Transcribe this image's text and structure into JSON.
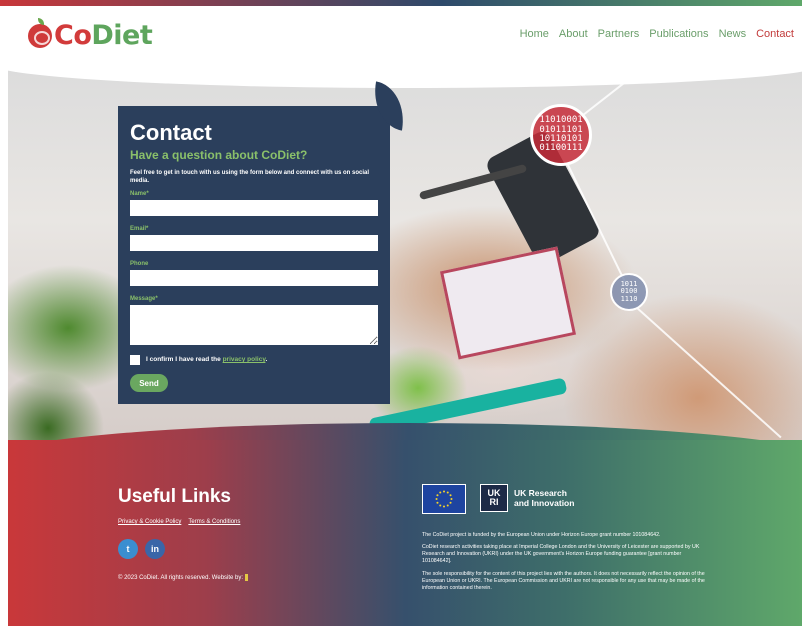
{
  "brand": {
    "logo_co": "Co",
    "logo_diet": "Diet"
  },
  "nav": {
    "items": [
      "Home",
      "About",
      "Partners",
      "Publications",
      "News",
      "Contact"
    ],
    "active": "Contact"
  },
  "hero": {
    "binary_red": "11010001\n01011101\n10110101\n01100111",
    "binary_blue": "1011\n0100\n1110"
  },
  "contact": {
    "title": "Contact",
    "subtitle": "Have a question about CoDiet?",
    "intro": "Feel free to get in touch with us using the form below and connect with us on social media.",
    "fields": [
      {
        "label": "Name*",
        "value": ""
      },
      {
        "label": "Email*",
        "value": ""
      },
      {
        "label": "Phone",
        "value": ""
      },
      {
        "label": "Message*",
        "value": ""
      }
    ],
    "consent_prefix": "I confirm I have read the ",
    "consent_link": "privacy policy",
    "consent_suffix": ".",
    "send_label": "Send"
  },
  "footer": {
    "title": "Useful Links",
    "links": [
      "Privacy & Cookie Policy",
      "Terms & Conditions"
    ],
    "social": {
      "twitter": "t",
      "linkedin": "in"
    },
    "copyright": "© 2023 CoDiet. All rights reserved. Website by:",
    "ukri_mark": "UK\nRI",
    "ukri_line1": "UK Research",
    "ukri_line2": "and Innovation",
    "funding": [
      "The CoDiet project is funded by the European Union under Horizon Europe grant number 101084642.",
      "CoDiet research activities taking place at Imperial College London and the University of Leicester are supported by UK Research and Innovation (UKRI) under the UK government's Horizon Europe funding guarantee [grant number 101084642].",
      "The sole responsibility for the content of this project lies with the authors. It does not necessarily reflect the opinion of the European Union or UKRI. The European Commission and UKRI are not responsible for any use that may be made of the information contained therein."
    ]
  },
  "colors": {
    "red": "#c9383a",
    "navy": "#2b3f5c",
    "green": "#5fa86a",
    "nav_green": "#6a9e6a"
  }
}
